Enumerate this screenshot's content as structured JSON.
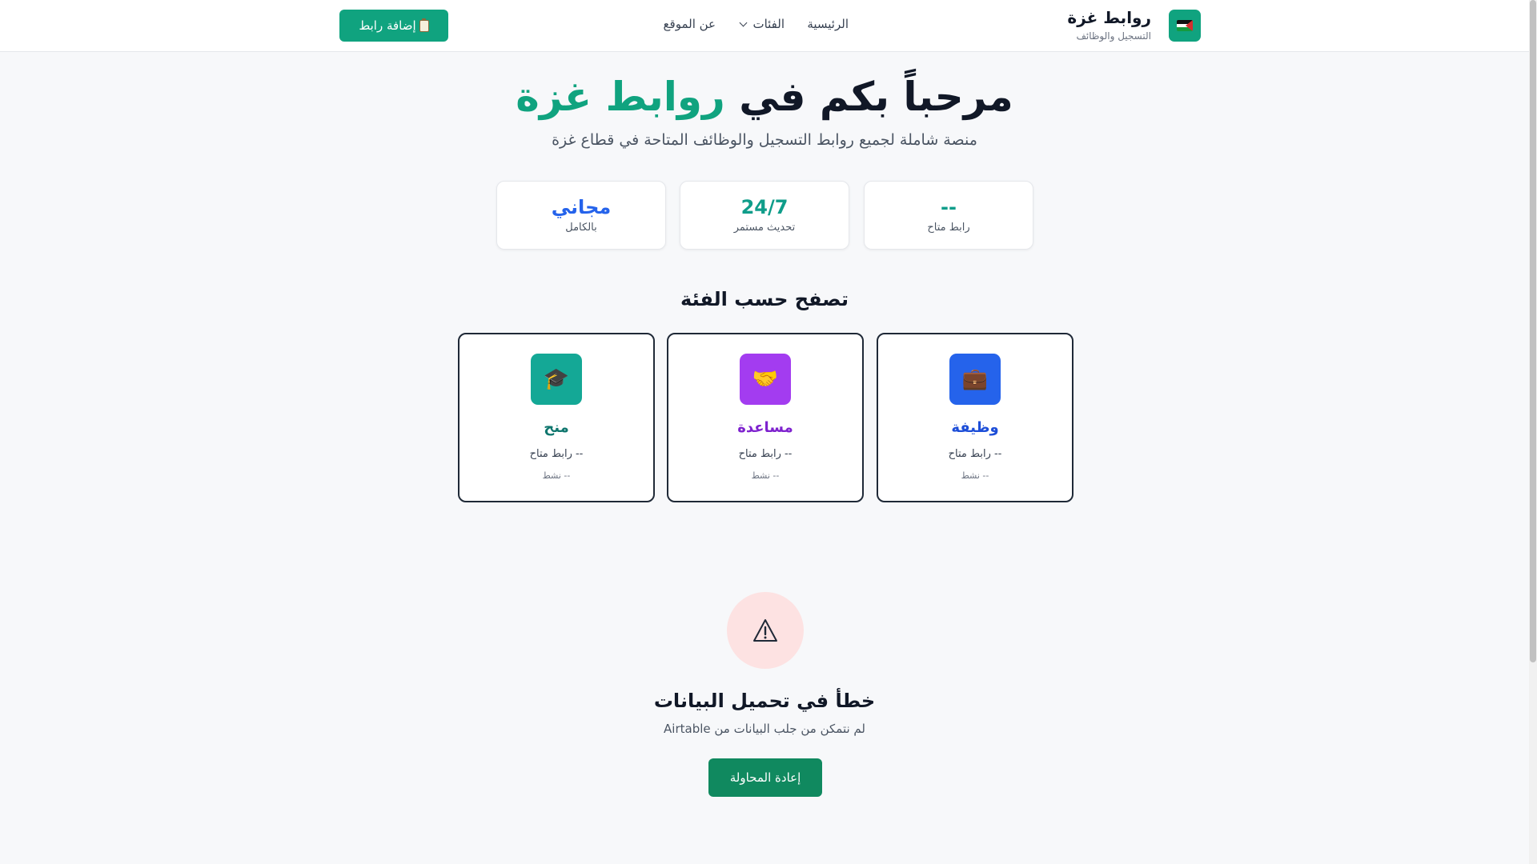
{
  "header": {
    "brand_title": "روابط غزة",
    "brand_subtitle": "التسجيل والوظائف",
    "nav": {
      "home": "الرئيسية",
      "categories": "الفئات",
      "about": "عن الموقع"
    },
    "add_link_label": "إضافة رابط"
  },
  "hero": {
    "title_prefix": "مرحباً بكم في ",
    "title_accent": "روابط غزة",
    "subtitle": "منصة شاملة لجميع روابط التسجيل والوظائف المتاحة في قطاع غزة"
  },
  "stats": [
    {
      "value": "--",
      "label": "رابط متاح",
      "color": "#0f9d8a"
    },
    {
      "value": "24/7",
      "label": "تحديث مستمر",
      "color": "#0f9d8a"
    },
    {
      "value": "مجاني",
      "label": "بالكامل",
      "color": "#2563eb"
    }
  ],
  "section_title": "تصفح حسب الفئة",
  "categories": [
    {
      "name": "وظيفة",
      "count": "-- رابط متاح",
      "active": "-- نشط",
      "icon": "briefcase-icon",
      "color": "#1d4ed8",
      "bg": "#2563eb"
    },
    {
      "name": "مساعدة",
      "count": "-- رابط متاح",
      "active": "-- نشط",
      "icon": "handshake-icon",
      "color": "#7e22ce",
      "bg": "#a33cf0"
    },
    {
      "name": "منح",
      "count": "-- رابط متاح",
      "active": "-- نشط",
      "icon": "graduation-cap-icon",
      "color": "#0f766e",
      "bg": "#14a896"
    }
  ],
  "error": {
    "icon": "warning-icon",
    "title": "خطأ في تحميل البيانات",
    "message": "لم نتمكن من جلب البيانات من Airtable",
    "retry_label": "إعادة المحاولة"
  }
}
